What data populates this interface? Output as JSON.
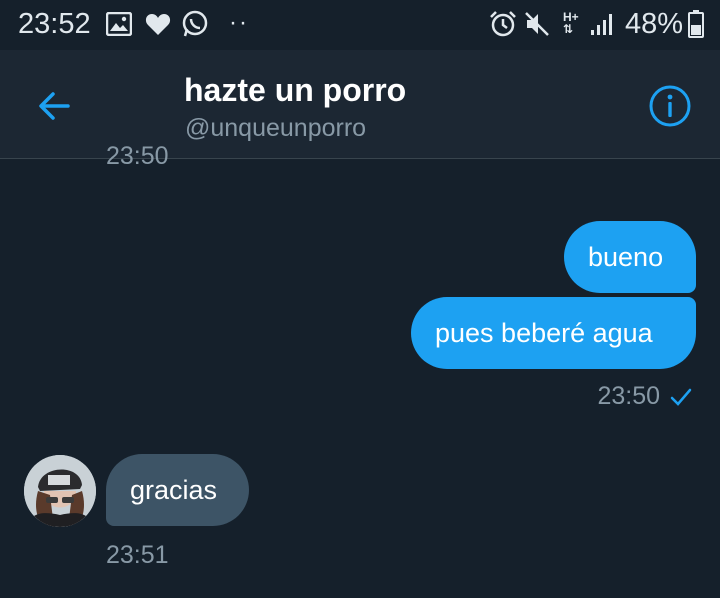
{
  "status_bar": {
    "time": "23:52",
    "dots": "··",
    "network": "H+",
    "battery": "48%",
    "icons": [
      "gallery-icon",
      "heart-icon",
      "whatsapp-icon",
      "alarm-icon",
      "mute-icon",
      "network-icon",
      "signal-icon",
      "battery-icon"
    ]
  },
  "header": {
    "title": "hazte un porro",
    "handle": "@unqueunporro"
  },
  "conversation": {
    "previous_time": "23:50",
    "messages": [
      {
        "text": "bueno",
        "direction": "out"
      },
      {
        "text": "pues beberé agua",
        "direction": "out"
      },
      {
        "text": "gracias",
        "direction": "in"
      }
    ],
    "out_time": "23:50",
    "in_time": "23:51"
  },
  "colors": {
    "background": "#15202b",
    "header": "#1c2733",
    "accent": "#1da1f2",
    "incoming_bubble": "#3d5466",
    "muted_text": "#8899a6"
  }
}
